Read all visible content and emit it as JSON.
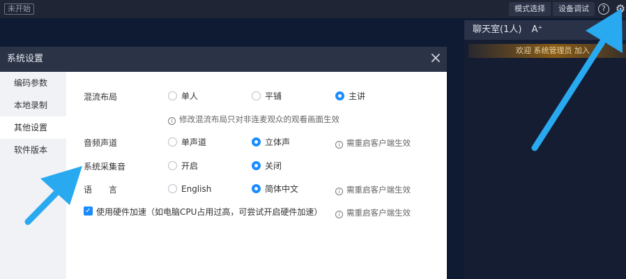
{
  "topbar": {
    "status": "未开始",
    "mode_button": "模式选择",
    "device_button": "设备调试",
    "help_icon": "?",
    "settings_icon": "⚙"
  },
  "chat": {
    "title": "聊天室(1人)",
    "font_icon": "A⁺",
    "welcome": "欢迎 系统管理员 加入"
  },
  "dialog": {
    "title": "系统设置",
    "close": "×",
    "nav": [
      {
        "label": "编码参数"
      },
      {
        "label": "本地录制"
      },
      {
        "label": "其他设置"
      },
      {
        "label": "软件版本"
      }
    ],
    "mix_layout": {
      "label": "混流布局",
      "options": [
        "单人",
        "平铺",
        "主讲"
      ],
      "selected": "主讲",
      "hint": "修改混流布局只对非连麦观众的观看画面生效"
    },
    "audio_channel": {
      "label": "音频声道",
      "options": [
        "单声道",
        "立体声"
      ],
      "selected": "立体声",
      "hint": "需重启客户端生效"
    },
    "system_audio": {
      "label": "系统采集音",
      "options": [
        "开启",
        "关闭"
      ],
      "selected": "关闭"
    },
    "language": {
      "label": "语　　言",
      "options": [
        "English",
        "简体中文"
      ],
      "selected": "简体中文",
      "hint": "需重启客户端生效"
    },
    "hardware_accel": {
      "label": "使用硬件加速（如电脑CPU占用过高，可尝试开启硬件加速）",
      "checked": true,
      "hint": "需重启客户端生效"
    },
    "info_icon": "i"
  },
  "colors": {
    "accent": "#1a8cff",
    "arrow": "#29a9ef",
    "background": "#0f1a33"
  }
}
